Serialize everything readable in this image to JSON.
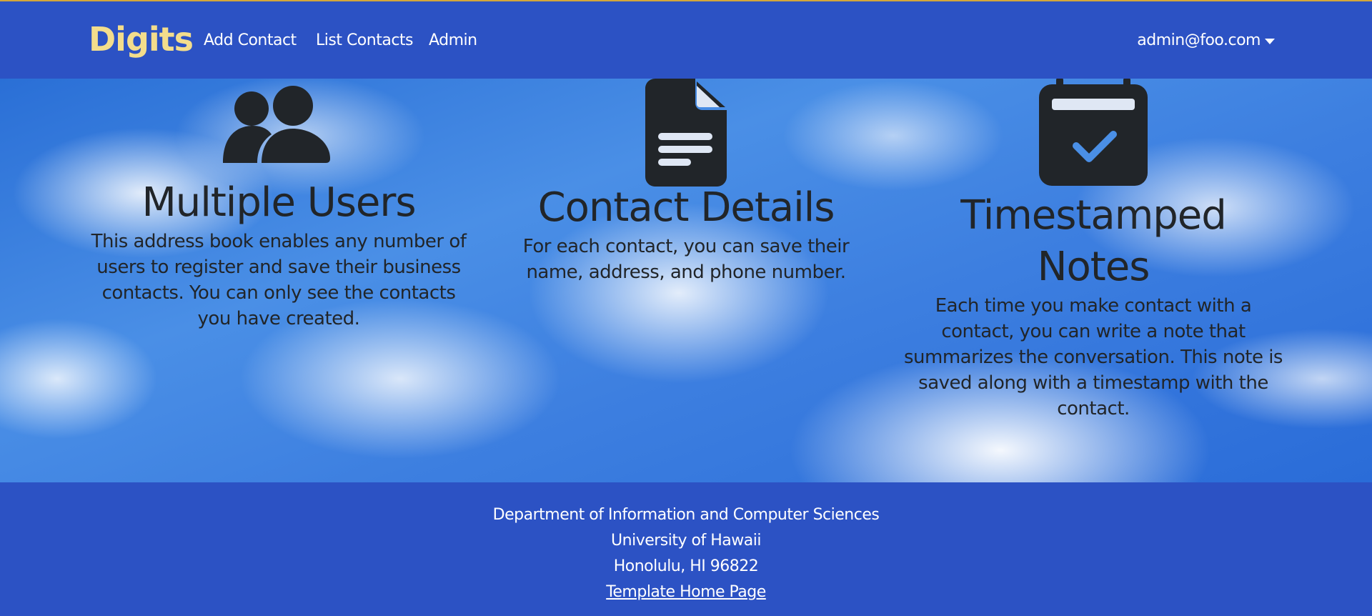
{
  "navbar": {
    "brand": "Digits",
    "links": [
      {
        "label": "Add Contact"
      },
      {
        "label": "List Contacts"
      },
      {
        "label": "Admin"
      }
    ],
    "user": "admin@foo.com"
  },
  "features": [
    {
      "icon": "users-icon",
      "title": "Multiple Users",
      "description": "This address book enables any number of users to register and save their business contacts. You can only see the contacts you have created."
    },
    {
      "icon": "file-text-icon",
      "title": "Contact Details",
      "description": "For each contact, you can save their name, address, and phone number."
    },
    {
      "icon": "calendar-check-icon",
      "title": "Timestamped Notes",
      "description": "Each time you make contact with a contact, you can write a note that summarizes the conversation. This note is saved along with a timestamp with the contact."
    }
  ],
  "footer": {
    "line1": "Department of Information and Computer Sciences",
    "line2": "University of Hawaii",
    "line3": "Honolulu, HI 96822",
    "link": "Template Home Page"
  },
  "colors": {
    "navbar_bg": "#2c52c4",
    "brand": "#f3dd8c",
    "text_dark": "#212529",
    "top_accent": "#d4a63a"
  }
}
